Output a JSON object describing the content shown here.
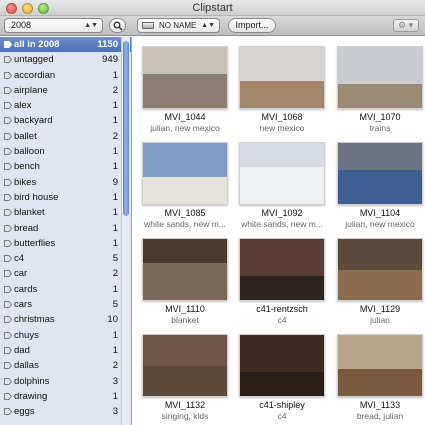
{
  "window": {
    "title": "Clipstart"
  },
  "toolbar": {
    "year_selected": "2008",
    "volume_selected": "NO NAME",
    "import_label": "Import...",
    "gear_label": "⚙ ▾"
  },
  "sidebar": {
    "items": [
      {
        "label": "all in 2008",
        "count": "1150"
      },
      {
        "label": "untagged",
        "count": "949"
      },
      {
        "label": "accordian",
        "count": "1"
      },
      {
        "label": "airplane",
        "count": "2"
      },
      {
        "label": "alex",
        "count": "1"
      },
      {
        "label": "backyard",
        "count": "1"
      },
      {
        "label": "ballet",
        "count": "2"
      },
      {
        "label": "balloon",
        "count": "1"
      },
      {
        "label": "bench",
        "count": "1"
      },
      {
        "label": "bikes",
        "count": "9"
      },
      {
        "label": "bird house",
        "count": "1"
      },
      {
        "label": "blanket",
        "count": "1"
      },
      {
        "label": "bread",
        "count": "1"
      },
      {
        "label": "butterflies",
        "count": "1"
      },
      {
        "label": "c4",
        "count": "5"
      },
      {
        "label": "car",
        "count": "2"
      },
      {
        "label": "cards",
        "count": "1"
      },
      {
        "label": "cars",
        "count": "5"
      },
      {
        "label": "christmas",
        "count": "10"
      },
      {
        "label": "chuys",
        "count": "1"
      },
      {
        "label": "dad",
        "count": "1"
      },
      {
        "label": "dallas",
        "count": "2"
      },
      {
        "label": "dolphins",
        "count": "3"
      },
      {
        "label": "drawing",
        "count": "1"
      },
      {
        "label": "eggs",
        "count": "3"
      }
    ]
  },
  "clips": [
    {
      "name": "MVI_1044",
      "tags": "julian, new mexico",
      "sky": "#c9c2b8",
      "ground": "#8a7f72",
      "ground_h": 55
    },
    {
      "name": "MVI_1068",
      "tags": "new mexico",
      "sky": "#d7d4d2",
      "ground": "#a2876b",
      "ground_h": 45
    },
    {
      "name": "MVI_1070",
      "tags": "trains",
      "sky": "#c8ccd0",
      "ground": "#9a8a73",
      "ground_h": 40
    },
    {
      "name": "MVI_1085",
      "tags": "white sands, new m...",
      "sky": "#7e9cc4",
      "ground": "#e6e2dc",
      "ground_h": 45
    },
    {
      "name": "MVI_1092",
      "tags": "white sands, new m...",
      "sky": "#d6dbe3",
      "ground": "#eef0f2",
      "ground_h": 60
    },
    {
      "name": "MVI_1104",
      "tags": "julian, new mexico",
      "sky": "#6b7480",
      "ground": "#3f5f93",
      "ground_h": 55
    },
    {
      "name": "MVI_1110",
      "tags": "blanket",
      "sky": "#4a3a2e",
      "ground": "#7b6a58",
      "ground_h": 60
    },
    {
      "name": "c41-rentzsch",
      "tags": "c4",
      "sky": "#5a3d32",
      "ground": "#2e2521",
      "ground_h": 40
    },
    {
      "name": "MVI_1129",
      "tags": "julian",
      "sky": "#5c4a3c",
      "ground": "#8b6c4e",
      "ground_h": 50
    },
    {
      "name": "MVI_1132",
      "tags": "singing, kids",
      "sky": "#6e5648",
      "ground": "#5d4a3a",
      "ground_h": 50
    },
    {
      "name": "c41-shipley",
      "tags": "c4",
      "sky": "#3f2a22",
      "ground": "#2a1e18",
      "ground_h": 40
    },
    {
      "name": "MVI_1133",
      "tags": "bread, julian",
      "sky": "#b9a58c",
      "ground": "#7a5a3e",
      "ground_h": 45
    }
  ]
}
